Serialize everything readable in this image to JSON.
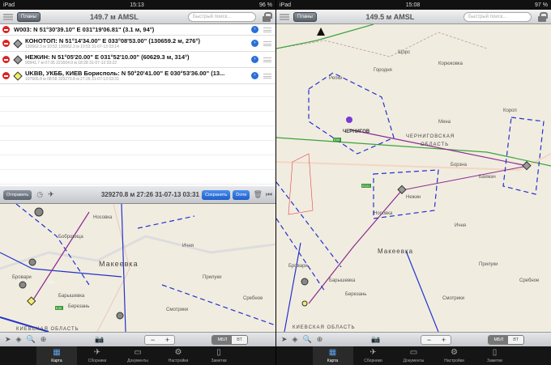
{
  "left": {
    "status": {
      "device": "iPad",
      "time": "15:13",
      "battery": "96 %"
    },
    "nav": {
      "plans": "Планы",
      "altitude": "149.7 м AMSL",
      "search_placeholder": "Быстрый поиск..."
    },
    "waypoints": [
      {
        "title": "W003: N 51°30'39.10\" E 031°19'06.81\" (3.1 м, 94°)",
        "sub": "",
        "color": ""
      },
      {
        "title": "КОНОТОП: N 51°14'34.00\" E 033°08'53.00\" (130659.2 м, 276°)",
        "sub": "130662.3 м 10:53 130662.3 м 10:53 31-07-13 03:14",
        "color": "#9a9a9a"
      },
      {
        "title": "НЕЖИН: N 51°05'20.00\" E 031°52'10.00\" (60629.3 м, 314°)",
        "sub": "90941.7 м 07:35 221604.0 м 18:28 31-07-13 03:22",
        "color": "#9a9a9a"
      },
      {
        "title": "UKBB, УКББ, КИЕВ Борисполь: N 50°20'41.00\" E 030°53'36.00\" (13...",
        "sub": "107666.8 м 08:58 329270.8 м 27:26 31-07-13 03:31",
        "color": "#f2ee6a"
      }
    ],
    "route_toolbar": {
      "send": "Отправить",
      "summary": "329270.8 м 27:26 31-07-13 03:31",
      "save": "Сохранить",
      "done": "Done"
    },
    "map_labels": [
      "Носовка",
      "Бобровица",
      "Ичня",
      "Макеевка",
      "Прилуки",
      "Сребное",
      "Барышевка",
      "Березань",
      "Бровари",
      "Смотрики",
      "КИЕВСКАЯ ОБЛАСТЬ",
      "E95",
      "E40"
    ]
  },
  "right": {
    "status": {
      "device": "iPad",
      "time": "15:08",
      "battery": "97 %"
    },
    "nav": {
      "plans": "Планы",
      "altitude": "149.5 м AMSL",
      "search_placeholder": "Быстрый поиск..."
    },
    "map_labels": [
      "Щорс",
      "Корюковка",
      "Репки",
      "Городня",
      "Мена",
      "Короп",
      "ЧЕРНИГОВ",
      "ЧЕРНИГОВСКАЯ",
      "ОБЛАСТЬ",
      "Борзна",
      "Бахмач",
      "Нежин",
      "Носовка",
      "Ичня",
      "Макеевка",
      "Прилуки",
      "Сребное",
      "Барышевка",
      "Березань",
      "Бровари",
      "Смотрики",
      "КИЕВСКАЯ ОБЛАСТЬ",
      "E95",
      "E101"
    ]
  },
  "bottom_toolbar": {
    "mode_on": "МБЛ",
    "mode_off": "ВТ"
  },
  "tabs": [
    {
      "label": "Карта",
      "icon": "map-icon"
    },
    {
      "label": "Сборники",
      "icon": "airplane-icon"
    },
    {
      "label": "Документы",
      "icon": "tray-icon"
    },
    {
      "label": "Настройки",
      "icon": "gear-icon"
    },
    {
      "label": "Заметки",
      "icon": "notepad-icon"
    }
  ]
}
